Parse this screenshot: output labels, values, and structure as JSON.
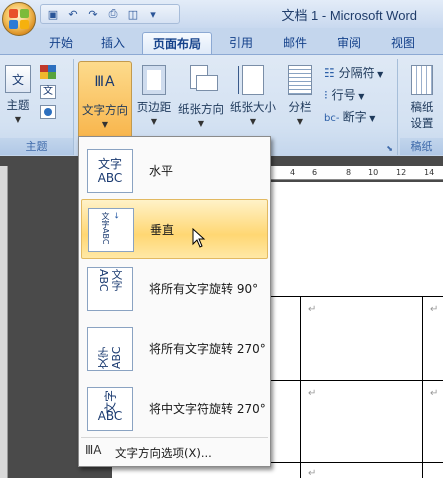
{
  "window": {
    "title": "文档 1 - Microsoft Word"
  },
  "tabs": [
    {
      "label": "开始"
    },
    {
      "label": "插入"
    },
    {
      "label": "页面布局"
    },
    {
      "label": "引用"
    },
    {
      "label": "邮件"
    },
    {
      "label": "审阅"
    },
    {
      "label": "视图"
    }
  ],
  "active_tab": "页面布局",
  "ribbon": {
    "theme_group": {
      "label": "主题",
      "buttons": {
        "theme": "主题"
      }
    },
    "page_setup": {
      "text_direction": "文字方向",
      "margins": "页边距",
      "orientation": "纸张方向",
      "size": "纸张大小",
      "columns": "分栏",
      "breaks": "分隔符",
      "line_numbers": "行号",
      "hyphenation": "断字"
    },
    "manuscript": {
      "label": "稿纸",
      "button_line1": "稿纸",
      "button_line2": "设置"
    }
  },
  "menu": {
    "items": [
      {
        "label": "水平",
        "icon": "text-horizontal-icon",
        "icon_text": [
          "文字",
          "ABC"
        ]
      },
      {
        "label": "垂直",
        "icon": "text-vertical-icon",
        "icon_text": "文字ABC"
      },
      {
        "label": "将所有文字旋转 90°",
        "icon": "text-rotate-90-icon",
        "icon_text": "文字ABC"
      },
      {
        "label": "将所有文字旋转 270°",
        "icon": "text-rotate-270-icon",
        "icon_text": "文字ABC"
      },
      {
        "label": "将中文字符旋转 270°",
        "icon": "text-rotate-cjk-270-icon",
        "icon_text": [
          "文字",
          "ABC"
        ]
      }
    ],
    "hovered_index": 1,
    "footer": {
      "label": "文字方向选项(X)...",
      "icon": "text-direction-options-icon"
    }
  },
  "ruler": {
    "ticks": [
      "4",
      "6",
      "8",
      "10",
      "12",
      "14"
    ]
  },
  "colors": {
    "hover": "#ffd773",
    "ribbon": "#d3e1f2",
    "tab_text": "#15428b"
  }
}
